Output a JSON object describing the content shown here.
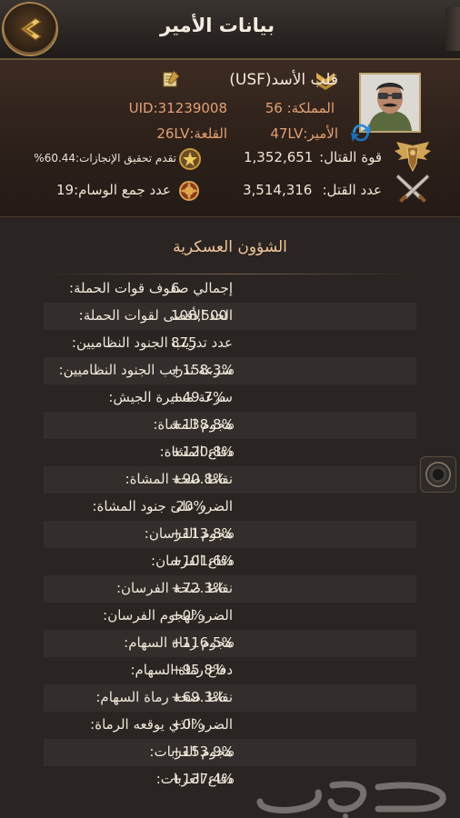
{
  "header": {
    "title": "بيانات الأمير"
  },
  "profile": {
    "name": "قلب الأسد(USF)",
    "kingdom": "المملكة: 56",
    "uid": "31239008:UID",
    "prince_level": "الأمير:47LV",
    "castle_level": "القلعة:26LV",
    "combat_power_label": "قوة القتال:",
    "combat_power_value": "1,352,651",
    "kills_label": "عدد القتل:",
    "kills_value": "3,514,316",
    "achievements": "تقدم تحقيق الإنجازات:60.44%",
    "medals": "عدد جمع الوسام:19"
  },
  "military": {
    "title": "الشؤون العسكرية",
    "rows": [
      {
        "label": "إجمالي صفوف قوات الحملة:",
        "value": "6"
      },
      {
        "label": "الحد الأقصى لقوات الحملة:",
        "value": "108,500"
      },
      {
        "label": "عدد تدريب الجنود النظاميين:",
        "value": "875"
      },
      {
        "label": "سرعة تدريب الجنود النظاميين:",
        "value": "+158.3%"
      },
      {
        "label": "سرعة مسيرة الجيش:",
        "value": "+49.7%"
      },
      {
        "label": "هجوم المشاة:",
        "value": "+138.8%"
      },
      {
        "label": "دفاع المشاة:",
        "value": "+120.8%"
      },
      {
        "label": "نقاط صحة المشاة:",
        "value": "+90.8%"
      },
      {
        "label": "الضرر على جنود المشاة:",
        "value": "-20%"
      },
      {
        "label": "هجوم الفرسان:",
        "value": "+113.8%"
      },
      {
        "label": "دفاع الفرسان:",
        "value": "+101.6%"
      },
      {
        "label": "نقاط صحة الفرسان:",
        "value": "+72.3%"
      },
      {
        "label": "الضرر لهجوم الفرسان:",
        "value": "+0%"
      },
      {
        "label": "هجوم رماة السهام:",
        "value": "+116.5%"
      },
      {
        "label": "دفاع رماة السهام:",
        "value": "+95.8%"
      },
      {
        "label": "نقاط صحة رماة السهام:",
        "value": "+69.3%"
      },
      {
        "label": "الضرر الذي يوقعه الرماة:",
        "value": "+0%"
      },
      {
        "label": "هجوم العربات:",
        "value": "+153.9%"
      },
      {
        "label": "دفاع العربات:",
        "value": "+137.4%"
      }
    ]
  },
  "watermark": {
    "text": "حراج"
  }
}
